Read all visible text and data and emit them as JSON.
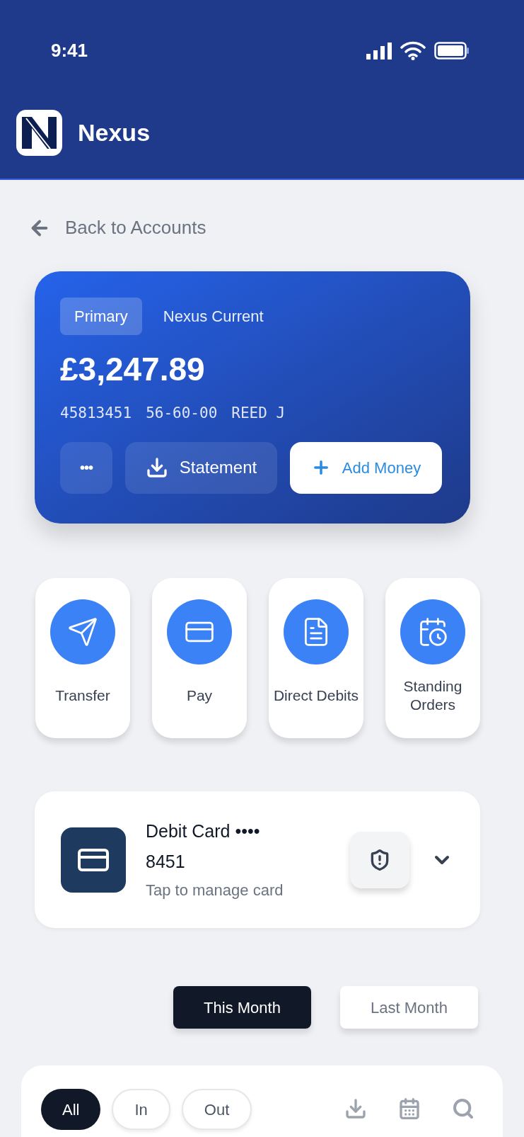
{
  "status_bar": {
    "time": "9:41"
  },
  "app_bar": {
    "title": "Nexus"
  },
  "back_link": {
    "label": "Back to Accounts"
  },
  "account_card": {
    "badge": "Primary",
    "name": "Nexus Current",
    "balance": "£3,247.89",
    "account_number": "45813451",
    "sort_code": "56-60-00",
    "holder": "REED J",
    "buttons": [
      {
        "kind": "more",
        "label": "•••"
      },
      {
        "kind": "statement",
        "label": "Statement"
      },
      {
        "kind": "add",
        "label": "Add Money"
      }
    ]
  },
  "actions": [
    {
      "kind": "transfer",
      "label": "Transfer"
    },
    {
      "kind": "pay",
      "label": "Pay"
    },
    {
      "kind": "direct_debits",
      "label": "Direct Debits"
    },
    {
      "kind": "standing_orders",
      "label": "Standing Orders"
    }
  ],
  "debit_card": {
    "title": "Debit Card ••••",
    "number": "8451",
    "subtitle": "Tap to manage card",
    "expanded": false
  },
  "period_tabs": [
    {
      "label": "This Month",
      "selected": true
    },
    {
      "label": "Last Month",
      "selected": false
    }
  ],
  "filters": [
    {
      "label": "All",
      "selected": true
    },
    {
      "label": "In",
      "selected": false
    },
    {
      "label": "Out",
      "selected": false
    }
  ],
  "toolbar": [
    {
      "kind": "download"
    },
    {
      "kind": "calendar"
    },
    {
      "kind": "search"
    }
  ]
}
